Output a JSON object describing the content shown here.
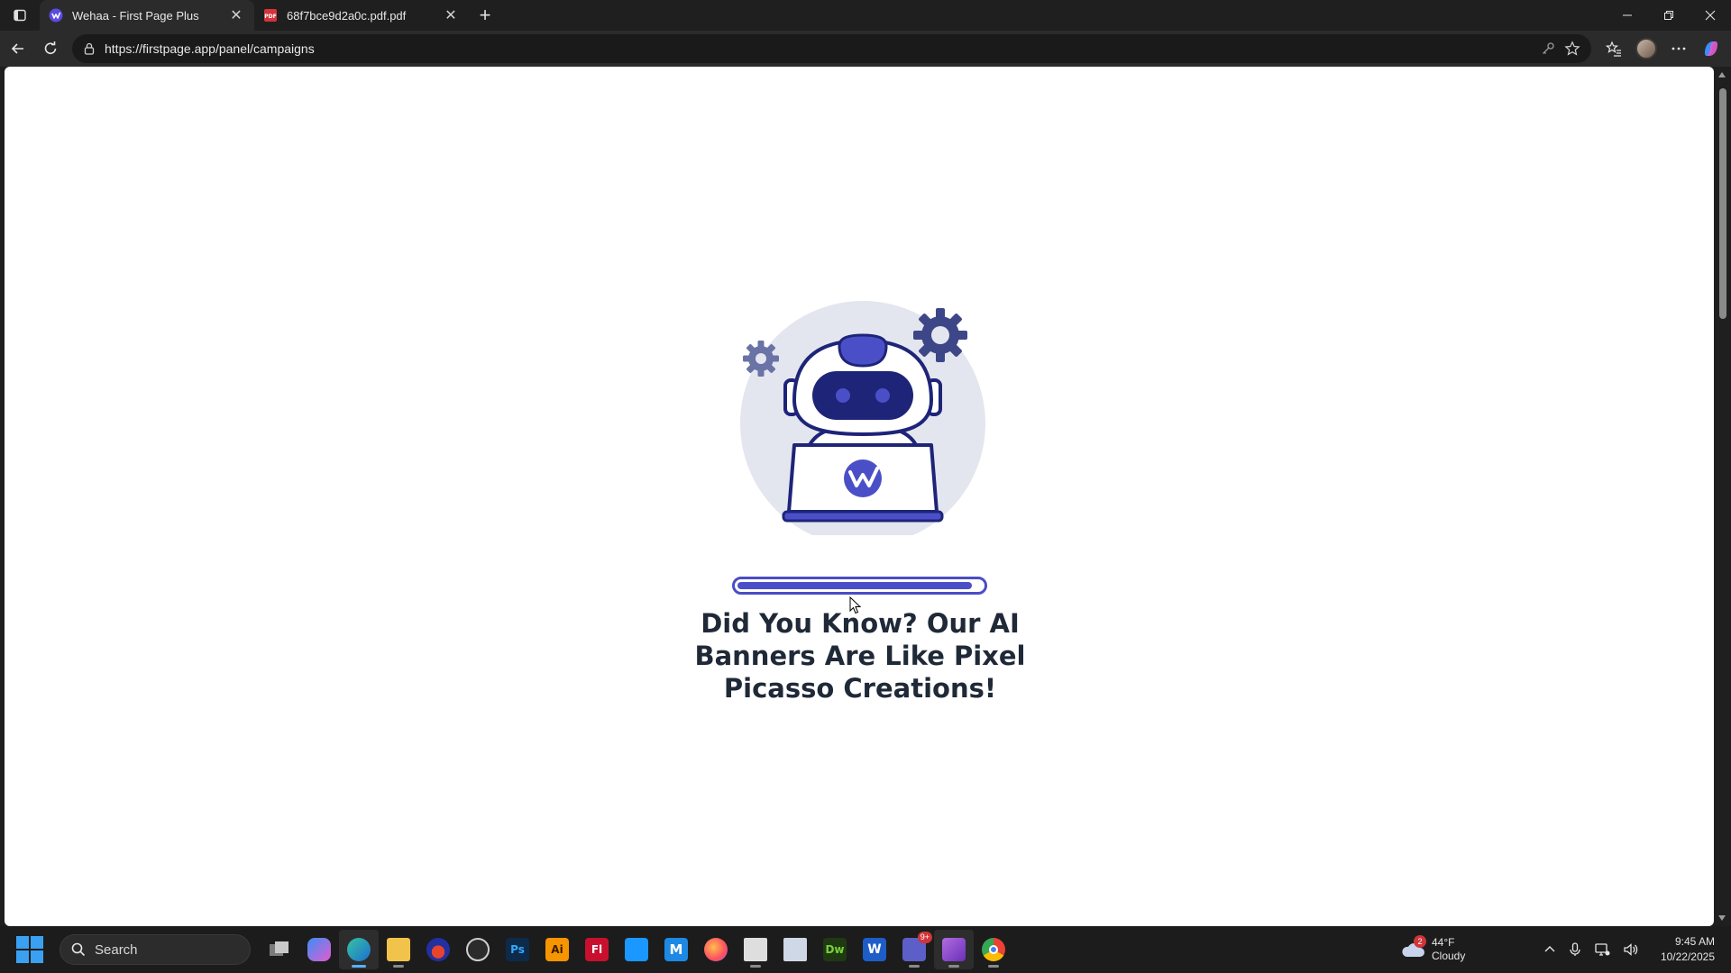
{
  "browser": {
    "tabs": [
      {
        "title": "Wehaa - First Page Plus",
        "active": true,
        "favicon": "wehaa-logo-icon"
      },
      {
        "title": "68f7bce9d2a0c.pdf.pdf",
        "active": false,
        "favicon": "pdf-icon"
      }
    ],
    "url": "https://firstpage.app/panel/campaigns"
  },
  "page": {
    "loader_progress_percent": 96,
    "headline": "Did You Know? Our AI Banners Are Like Pixel Picasso Creations!",
    "colors": {
      "accent": "#4b4fc7",
      "navy": "#1e2478",
      "circle": "#e3e6ef",
      "text": "#1f2937"
    }
  },
  "taskbar": {
    "search_label": "Search",
    "apps": [
      {
        "name": "task-view",
        "label": ""
      },
      {
        "name": "copilot",
        "label": ""
      },
      {
        "name": "edge",
        "label": ""
      },
      {
        "name": "file-explorer",
        "label": ""
      },
      {
        "name": "app-5",
        "label": ""
      },
      {
        "name": "obs",
        "label": ""
      },
      {
        "name": "photoshop",
        "label": "Ps"
      },
      {
        "name": "illustrator",
        "label": "Ai"
      },
      {
        "name": "flash",
        "label": "Fl"
      },
      {
        "name": "prime-video",
        "label": ""
      },
      {
        "name": "app-m",
        "label": "M"
      },
      {
        "name": "firefox",
        "label": ""
      },
      {
        "name": "app-13",
        "label": ""
      },
      {
        "name": "app-14",
        "label": ""
      },
      {
        "name": "dreamweaver",
        "label": "Dw"
      },
      {
        "name": "word",
        "label": "W"
      },
      {
        "name": "teams",
        "label": "",
        "badge": "9+"
      },
      {
        "name": "visual-studio",
        "label": ""
      },
      {
        "name": "chrome",
        "label": ""
      }
    ],
    "weather": {
      "temp": "44°F",
      "condition": "Cloudy",
      "badge": "2"
    },
    "clock": {
      "time": "9:45 AM",
      "date": "10/22/2025"
    }
  }
}
